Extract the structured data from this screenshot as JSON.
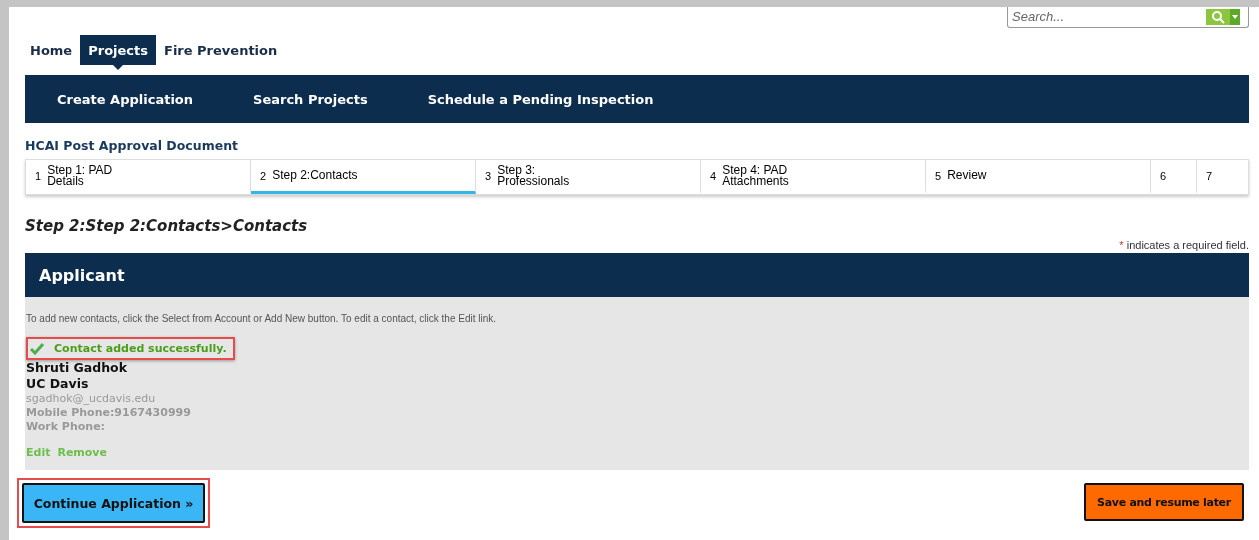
{
  "search": {
    "placeholder": "Search..."
  },
  "nav_tabs": [
    {
      "label": "Home",
      "selected": false
    },
    {
      "label": "Projects",
      "selected": true
    },
    {
      "label": "Fire Prevention",
      "selected": false
    }
  ],
  "sub_nav": [
    "Create Application",
    "Search Projects",
    "Schedule a Pending Inspection"
  ],
  "page_title": "HCAI Post Approval Document",
  "steps": [
    {
      "number": "1",
      "label": "Step 1: PAD\nDetails",
      "selected": false
    },
    {
      "number": "2",
      "label": "Step 2:Contacts",
      "selected": true
    },
    {
      "number": "3",
      "label": "Step 3:\nProfessionals",
      "selected": false
    },
    {
      "number": "4",
      "label": "Step 4: PAD\nAttachments",
      "selected": false
    },
    {
      "number": "5",
      "label": "Review",
      "selected": false
    },
    {
      "number": "6",
      "selected": false
    },
    {
      "number": "7",
      "selected": false
    }
  ],
  "step_heading": "Step 2:Step 2:Contacts>Contacts",
  "required_note": {
    "mark": "*",
    "text": "indicates a required field."
  },
  "section": {
    "title": "Applicant",
    "instructions": "To add new contacts, click the Select from Account or Add New button. To edit a contact, click the Edit link.",
    "message": {
      "text": "Contact added successfully.",
      "highlighted": true
    },
    "contact": {
      "name": "Shruti  Gadhok",
      "organization": "UC Davis",
      "email": "sgadhok@_ucdavis.edu",
      "mobile_phone": "Mobile Phone:9167430999",
      "work_phone": "Work Phone:"
    },
    "links": [
      "Edit",
      "Remove"
    ]
  },
  "buttons": [
    {
      "label": "Continue Application »",
      "kind": "primary",
      "highlighted": true
    },
    {
      "label": "Save and resume later",
      "kind": "secondary",
      "highlighted": false
    }
  ]
}
